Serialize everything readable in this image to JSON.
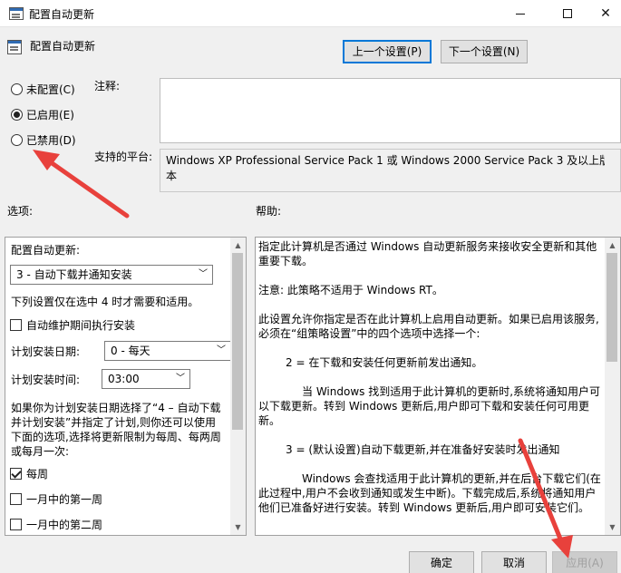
{
  "window": {
    "title": "配置自动更新"
  },
  "header": {
    "title": "配置自动更新"
  },
  "nav": {
    "prev_label": "上一个设置(P)",
    "next_label": "下一个设置(N)"
  },
  "state": {
    "options": [
      {
        "label": "未配置(C)",
        "selected": false
      },
      {
        "label": "已启用(E)",
        "selected": true
      },
      {
        "label": "已禁用(D)",
        "selected": false
      }
    ]
  },
  "labels": {
    "comment": "注释:",
    "platform": "支持的平台:",
    "options": "选项:",
    "help": "帮助:"
  },
  "platform": {
    "text": "Windows XP Professional Service Pack 1 或 Windows 2000 Service Pack 3 及以上版本"
  },
  "options_panel": {
    "configure_label": "配置自动更新:",
    "configure_value": "3 - 自动下载并通知安装",
    "note": "下列设置仅在选中 4 时才需要和适用。",
    "maintenance_label": "自动维护期间执行安装",
    "schedule_day_label": "计划安装日期:",
    "schedule_day_value": "0 - 每天",
    "schedule_time_label": "计划安装时间:",
    "schedule_time_value": "03:00",
    "desc_line1": "如果你为计划安装日期选择了“4 – 自动下载",
    "desc_line2": "并计划安装”并指定了计划,则你还可以使用",
    "desc_line3": "下面的选项,选择将更新限制为每周、每两周",
    "desc_line4": "或每月一次:",
    "weekly_label": "每周",
    "first_week_label": "一月中的第一周",
    "second_week_label": "一月中的第二周"
  },
  "help": {
    "p1": "指定此计算机是否通过 Windows 自动更新服务来接收安全更新和其他重要下载。",
    "p2": "注意: 此策略不适用于 Windows RT。",
    "p3": "此设置允许你指定是否在此计算机上启用自动更新。如果已启用该服务,必须在“组策略设置”中的四个选项中选择一个:",
    "p4": "2 = 在下载和安装任何更新前发出通知。",
    "p5": "当 Windows 找到适用于此计算机的更新时,系统将通知用户可以下载更新。转到 Windows 更新后,用户即可下载和安装任何可用更新。",
    "p6": "3 = (默认设置)自动下载更新,并在准备好安装时发出通知",
    "p7": "Windows 会查找适用于此计算机的更新,并在后台下载它们(在此过程中,用户不会收到通知或发生中断)。下载完成后,系统将通知用户他们已准备好进行安装。转到 Windows 更新后,用户即可安装它们。"
  },
  "footer": {
    "ok_label": "确定",
    "cancel_label": "取消",
    "apply_label": "应用(A)"
  },
  "colors": {
    "annotation_arrow": "#e8413c",
    "focus_border": "#0078d7"
  },
  "icons": {
    "app": "policy-window-icon",
    "minimize": "minimize-icon",
    "maximize": "maximize-icon",
    "close": "close-icon"
  }
}
